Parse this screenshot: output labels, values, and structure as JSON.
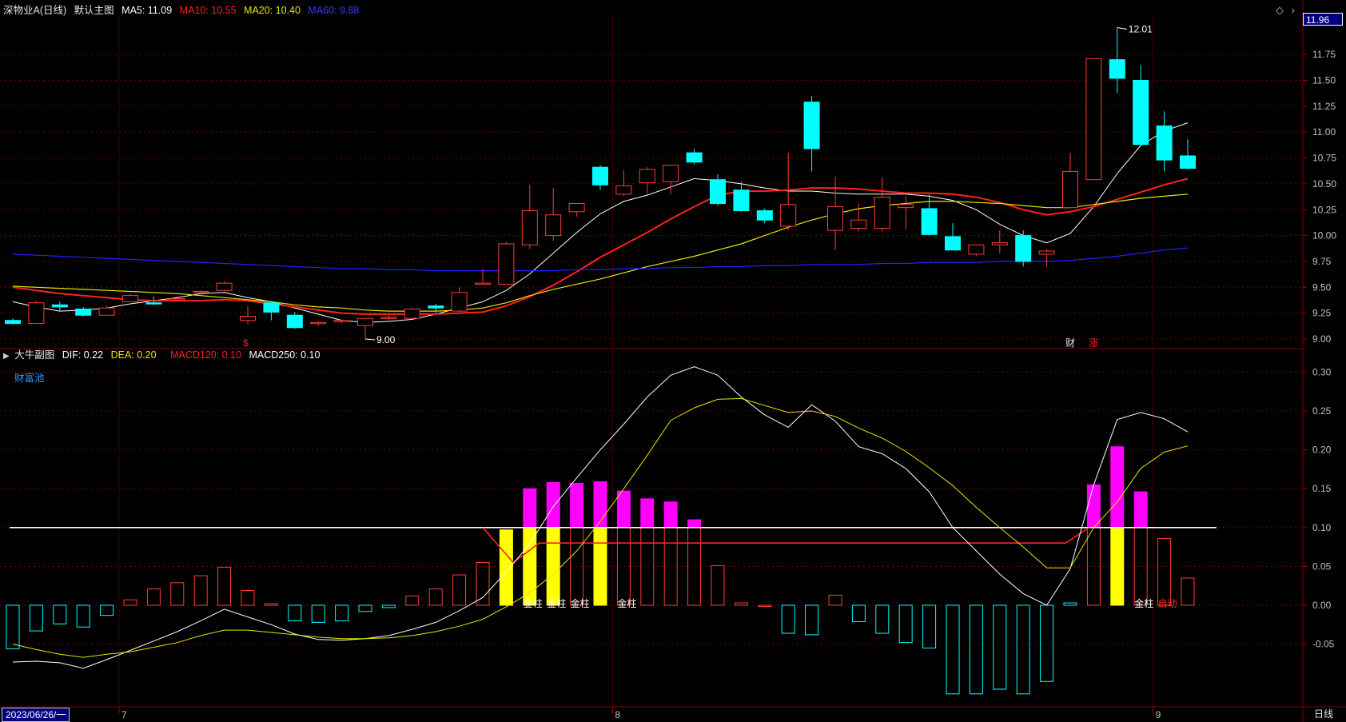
{
  "header": {
    "title": "深物业A(日线)",
    "layout": "默认主图",
    "ma5": "MA5: 11.09",
    "ma10": "MA10: 10.55",
    "ma20": "MA20: 10.40",
    "ma60": "MA60: 9.88"
  },
  "sub_header": {
    "title": "大牛副图",
    "dif": "DIF: 0.22",
    "dea": "DEA: 0.20",
    "macd120": "MACD120: 0.10",
    "macd250": "MACD250: 0.10",
    "pool": "财富池"
  },
  "footer": {
    "date": "2023/06/26/一",
    "period": "日线"
  },
  "current_price": "11.96",
  "colors": {
    "up": "#ff3b3b",
    "down": "#00ffff",
    "ma5": "#ffffff",
    "ma10": "#ff2020",
    "ma20": "#e6e600",
    "ma60": "#2424ff",
    "grid": "#7a0000",
    "axis_text": "#c0c0c0",
    "magenta": "#ff00ff",
    "yellow": "#ffff00"
  },
  "chart_data": [
    {
      "type": "candlestick",
      "title": "深物业A(日线)",
      "ylim": [
        8.9,
        12.1
      ],
      "yticks": [
        "9.00",
        "9.25",
        "9.50",
        "9.75",
        "10.00",
        "10.25",
        "10.50",
        "10.75",
        "11.00",
        "11.25",
        "11.50",
        "11.75"
      ],
      "x_labels": [
        {
          "index": 5,
          "label": "7"
        },
        {
          "index": 26,
          "label": "8"
        },
        {
          "index": 49,
          "label": "9"
        }
      ],
      "annotations": [
        {
          "text": "12.01",
          "index": 47,
          "value": 12.01
        },
        {
          "text": "9.00",
          "index": 15,
          "value": 9.0
        },
        {
          "text": "$",
          "index": 10,
          "kind": "marker-red"
        },
        {
          "text": "财",
          "index": 45,
          "kind": "marker-white"
        },
        {
          "text": "涨",
          "index": 46,
          "kind": "marker-red"
        }
      ],
      "candles": [
        [
          9.18,
          9.2,
          9.14,
          9.15
        ],
        [
          9.15,
          9.37,
          9.15,
          9.35
        ],
        [
          9.33,
          9.36,
          9.27,
          9.31
        ],
        [
          9.29,
          9.31,
          9.22,
          9.23
        ],
        [
          9.23,
          9.32,
          9.23,
          9.3
        ],
        [
          9.36,
          9.44,
          9.36,
          9.42
        ],
        [
          9.35,
          9.41,
          9.33,
          9.34
        ],
        [
          9.38,
          9.42,
          9.36,
          9.39
        ],
        [
          9.45,
          9.47,
          9.43,
          9.46
        ],
        [
          9.47,
          9.56,
          9.46,
          9.54
        ],
        [
          9.18,
          9.32,
          9.14,
          9.22
        ],
        [
          9.35,
          9.36,
          9.18,
          9.26
        ],
        [
          9.23,
          9.26,
          9.1,
          9.11
        ],
        [
          9.15,
          9.17,
          9.13,
          9.16
        ],
        [
          9.17,
          9.19,
          9.15,
          9.18
        ],
        [
          9.13,
          9.2,
          9.0,
          9.2
        ],
        [
          9.2,
          9.23,
          9.17,
          9.21
        ],
        [
          9.2,
          9.3,
          9.19,
          9.29
        ],
        [
          9.32,
          9.34,
          9.25,
          9.3
        ],
        [
          9.27,
          9.5,
          9.26,
          9.45
        ],
        [
          9.53,
          9.68,
          9.53,
          9.54
        ],
        [
          9.53,
          9.94,
          9.53,
          9.92
        ],
        [
          9.91,
          10.49,
          9.87,
          10.24
        ],
        [
          10.0,
          10.46,
          9.95,
          10.2
        ],
        [
          10.23,
          10.3,
          10.18,
          10.31
        ],
        [
          10.66,
          10.68,
          10.44,
          10.49
        ],
        [
          10.4,
          10.63,
          10.38,
          10.48
        ],
        [
          10.51,
          10.66,
          10.4,
          10.64
        ],
        [
          10.52,
          10.66,
          10.4,
          10.68
        ],
        [
          10.8,
          10.84,
          10.69,
          10.71
        ],
        [
          10.54,
          10.59,
          10.29,
          10.31
        ],
        [
          10.44,
          10.52,
          10.23,
          10.24
        ],
        [
          10.24,
          10.26,
          10.12,
          10.15
        ],
        [
          10.09,
          10.8,
          10.05,
          10.3
        ],
        [
          11.29,
          11.35,
          10.62,
          10.84
        ],
        [
          10.05,
          10.57,
          9.86,
          10.28
        ],
        [
          10.07,
          10.31,
          10.04,
          10.15
        ],
        [
          10.07,
          10.56,
          10.04,
          10.37
        ],
        [
          10.27,
          10.38,
          10.06,
          10.3
        ],
        [
          10.26,
          10.4,
          10.0,
          10.01
        ],
        [
          9.99,
          10.12,
          9.86,
          9.86
        ],
        [
          9.82,
          9.91,
          9.8,
          9.91
        ],
        [
          9.91,
          10.05,
          9.83,
          9.93
        ],
        [
          10.0,
          10.05,
          9.7,
          9.75
        ],
        [
          9.82,
          9.87,
          9.7,
          9.85
        ],
        [
          10.27,
          10.8,
          10.27,
          10.62
        ],
        [
          10.54,
          11.71,
          10.54,
          11.71
        ],
        [
          11.7,
          12.01,
          11.38,
          11.52
        ],
        [
          11.5,
          11.65,
          10.87,
          10.88
        ],
        [
          11.06,
          11.2,
          10.62,
          10.73
        ],
        [
          10.77,
          10.93,
          10.64,
          10.65
        ]
      ],
      "series": [
        {
          "name": "MA5",
          "values": [
            9.36,
            9.31,
            9.27,
            9.28,
            9.3,
            9.34,
            9.37,
            9.4,
            9.44,
            9.45,
            9.4,
            9.36,
            9.3,
            9.24,
            9.18,
            9.16,
            9.17,
            9.19,
            9.24,
            9.3,
            9.36,
            9.47,
            9.63,
            9.83,
            10.03,
            10.21,
            10.33,
            10.39,
            10.47,
            10.55,
            10.53,
            10.5,
            10.46,
            10.43,
            10.43,
            10.41,
            10.4,
            10.4,
            10.4,
            10.38,
            10.34,
            10.25,
            10.11,
            10.0,
            9.93,
            10.02,
            10.28,
            10.6,
            10.87,
            11.01,
            11.09
          ]
        },
        {
          "name": "MA10",
          "values": [
            9.5,
            9.47,
            9.44,
            9.42,
            9.4,
            9.38,
            9.37,
            9.37,
            9.37,
            9.38,
            9.37,
            9.34,
            9.31,
            9.28,
            9.25,
            9.24,
            9.24,
            9.24,
            9.24,
            9.25,
            9.26,
            9.32,
            9.41,
            9.52,
            9.65,
            9.79,
            9.91,
            10.03,
            10.16,
            10.28,
            10.39,
            10.43,
            10.43,
            10.44,
            10.46,
            10.46,
            10.45,
            10.43,
            10.41,
            10.41,
            10.4,
            10.37,
            10.32,
            10.25,
            10.2,
            10.23,
            10.28,
            10.35,
            10.42,
            10.49,
            10.55
          ]
        },
        {
          "name": "MA20",
          "values": [
            9.51,
            9.5,
            9.49,
            9.48,
            9.47,
            9.46,
            9.45,
            9.44,
            9.42,
            9.4,
            9.38,
            9.36,
            9.33,
            9.31,
            9.3,
            9.28,
            9.27,
            9.27,
            9.27,
            9.28,
            9.3,
            9.35,
            9.42,
            9.48,
            9.53,
            9.58,
            9.64,
            9.7,
            9.75,
            9.8,
            9.86,
            9.92,
            10.0,
            10.08,
            10.15,
            10.21,
            10.26,
            10.29,
            10.31,
            10.33,
            10.33,
            10.32,
            10.31,
            10.29,
            10.27,
            10.27,
            10.3,
            10.33,
            10.36,
            10.38,
            10.4
          ]
        },
        {
          "name": "MA60",
          "values": [
            9.82,
            9.81,
            9.8,
            9.79,
            9.78,
            9.77,
            9.76,
            9.75,
            9.74,
            9.73,
            9.72,
            9.71,
            9.7,
            9.69,
            9.68,
            9.68,
            9.67,
            9.67,
            9.66,
            9.66,
            9.66,
            9.66,
            9.66,
            9.66,
            9.67,
            9.67,
            9.68,
            9.68,
            9.69,
            9.69,
            9.7,
            9.7,
            9.71,
            9.71,
            9.72,
            9.72,
            9.72,
            9.73,
            9.73,
            9.74,
            9.74,
            9.74,
            9.75,
            9.75,
            9.75,
            9.76,
            9.78,
            9.8,
            9.83,
            9.86,
            9.88
          ]
        }
      ]
    },
    {
      "type": "bar",
      "title": "大牛副图",
      "ylim": [
        -0.09,
        0.33
      ],
      "yticks": [
        "-0.05",
        "0.00",
        "0.05",
        "0.10",
        "0.15",
        "0.20",
        "0.25",
        "0.30"
      ],
      "baseline": 0.1,
      "macd": [
        -0.056,
        -0.033,
        -0.024,
        -0.028,
        -0.013,
        0.007,
        0.021,
        0.029,
        0.038,
        0.049,
        0.019,
        0.002,
        -0.02,
        -0.022,
        -0.02,
        -0.008,
        -0.003,
        0.012,
        0.021,
        0.039,
        0.055,
        0.097,
        0.15,
        0.158,
        0.157,
        0.159,
        0.147,
        0.137,
        0.133,
        0.11,
        0.051,
        0.003,
        0.0,
        -0.036,
        -0.038,
        0.013,
        -0.021,
        -0.036,
        -0.048,
        -0.055,
        -0.114,
        -0.114,
        -0.108,
        -0.114,
        -0.098,
        0.003,
        0.155,
        0.204,
        0.146,
        0.086,
        0.035
      ],
      "bar_style": [
        "c",
        "c",
        "c",
        "c",
        "c",
        "r",
        "r",
        "r",
        "r",
        "r",
        "r",
        "r",
        "c",
        "c",
        "c",
        "c",
        "c",
        "r",
        "r",
        "r",
        "r",
        "y",
        "ym",
        "ym",
        "m",
        "ym",
        "m",
        "m",
        "m",
        "m",
        "r",
        "r",
        "r",
        "c",
        "c",
        "r",
        "c",
        "c",
        "c",
        "c",
        "c",
        "c",
        "c",
        "c",
        "c",
        "c",
        "rm",
        "ym",
        "rm",
        "r",
        "r"
      ],
      "bar_labels": [
        {
          "index": 22,
          "text": "金柱"
        },
        {
          "index": 23,
          "text": "金柱"
        },
        {
          "index": 24,
          "text": "金柱"
        },
        {
          "index": 26,
          "text": "金柱"
        },
        {
          "index": 48,
          "text": "金柱"
        },
        {
          "index": 49,
          "text": "启动"
        }
      ],
      "red_segment": {
        "from": 20,
        "to": 50,
        "value": 0.08,
        "start_value": 0.1
      },
      "series": [
        {
          "name": "DIF",
          "values": [
            -0.073,
            -0.072,
            -0.074,
            -0.081,
            -0.07,
            -0.058,
            -0.046,
            -0.034,
            -0.02,
            -0.005,
            -0.015,
            -0.025,
            -0.037,
            -0.044,
            -0.045,
            -0.043,
            -0.039,
            -0.031,
            -0.022,
            -0.007,
            0.01,
            0.043,
            0.079,
            0.127,
            0.164,
            0.2,
            0.233,
            0.268,
            0.296,
            0.307,
            0.296,
            0.268,
            0.245,
            0.229,
            0.258,
            0.237,
            0.204,
            0.195,
            0.176,
            0.146,
            0.1,
            0.07,
            0.04,
            0.015,
            0.0,
            0.047,
            0.155,
            0.239,
            0.248,
            0.24,
            0.223
          ]
        },
        {
          "name": "DEA",
          "values": [
            -0.05,
            -0.057,
            -0.063,
            -0.067,
            -0.063,
            -0.06,
            -0.054,
            -0.048,
            -0.039,
            -0.032,
            -0.032,
            -0.035,
            -0.038,
            -0.041,
            -0.043,
            -0.043,
            -0.042,
            -0.039,
            -0.034,
            -0.027,
            -0.018,
            -0.002,
            0.016,
            0.04,
            0.07,
            0.108,
            0.15,
            0.193,
            0.238,
            0.254,
            0.265,
            0.266,
            0.257,
            0.248,
            0.25,
            0.243,
            0.228,
            0.215,
            0.198,
            0.177,
            0.154,
            0.126,
            0.1,
            0.075,
            0.048,
            0.048,
            0.1,
            0.133,
            0.176,
            0.197,
            0.205
          ]
        }
      ]
    }
  ]
}
